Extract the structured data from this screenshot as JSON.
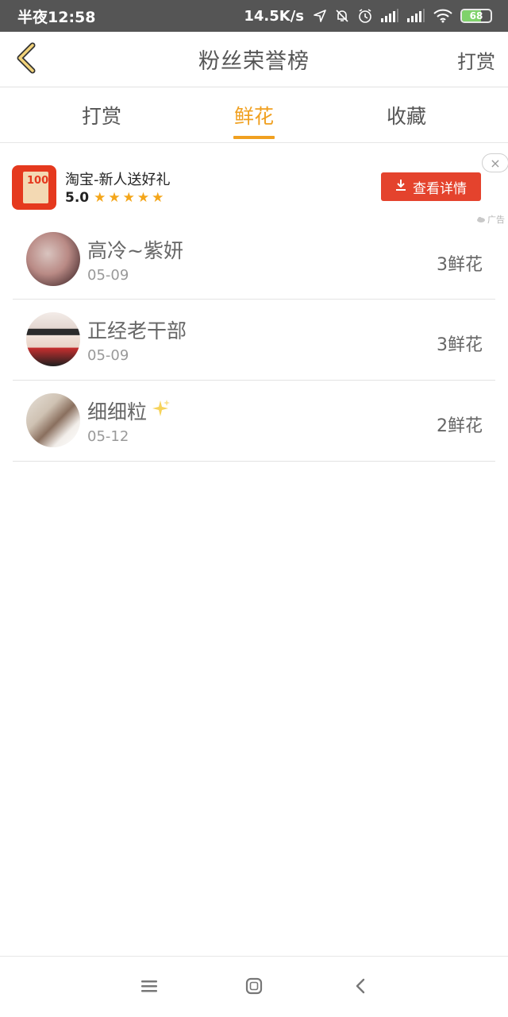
{
  "status": {
    "time": "半夜12:58",
    "speed": "14.5K/s",
    "battery": 68,
    "battery_text": "68"
  },
  "header": {
    "title": "粉丝荣誉榜",
    "action": "打赏"
  },
  "tabs": [
    {
      "label": "打赏",
      "active": false
    },
    {
      "label": "鲜花",
      "active": true
    },
    {
      "label": "收藏",
      "active": false
    }
  ],
  "ad": {
    "logo_text": "100",
    "title": "淘宝-新人送好礼",
    "rating": "5.0",
    "stars": 5,
    "button_label": "查看详情",
    "close_icon": "×",
    "mark": "广告",
    "colors": {
      "button": "#e4432d",
      "star": "#f4a61a"
    }
  },
  "fans": [
    {
      "name": "高冷~紫妍",
      "date": "05-09",
      "count": "3鲜花",
      "sparkle": false
    },
    {
      "name": "正经老干部",
      "date": "05-09",
      "count": "3鲜花",
      "sparkle": false
    },
    {
      "name": "细细粒",
      "date": "05-12",
      "count": "2鲜花",
      "sparkle": true
    }
  ],
  "theme": {
    "accent": "#f0a020"
  },
  "icons": {
    "back": "chevron-left-icon",
    "menu": "menu-icon",
    "home": "home-icon",
    "nav_back": "back-icon",
    "sparkle": "sparkle-icon"
  }
}
